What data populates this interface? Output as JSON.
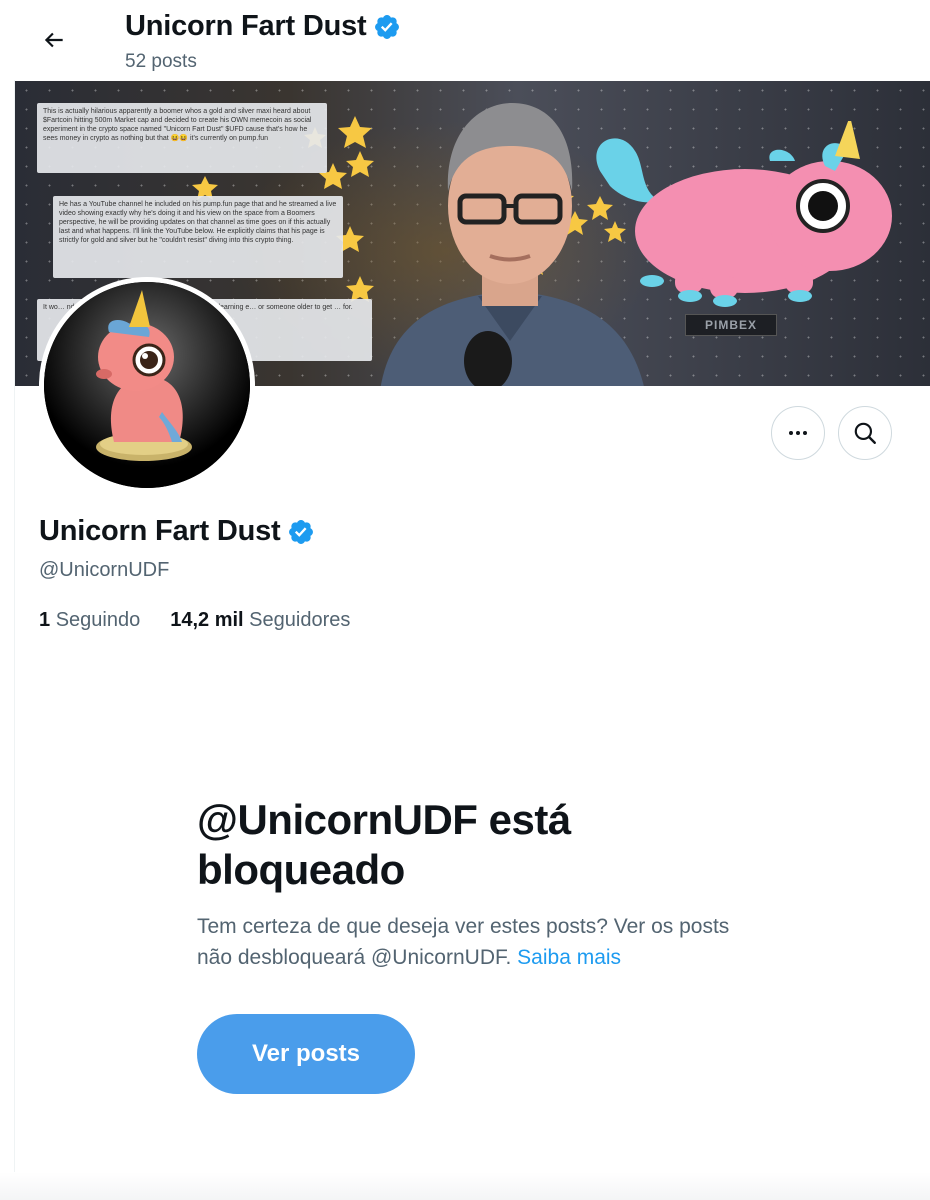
{
  "header": {
    "display_name": "Unicorn Fart Dust",
    "post_count": "52 posts"
  },
  "banner": {
    "caption_1": "This is actually hilarious apparently a boomer whos a gold and silver maxi heard about $Fartcoin hitting 500m Market cap and decided to create his OWN memecoin as social experiment in the crypto space named \"Unicorn Fart Dust\" $UFD cause that's how he sees money in crypto as nothing but that 😆😆 it's currently on pump.fun",
    "caption_2": "He has a YouTube channel he included on his pump.fun page that and he streamed a live video showing exactly why he's doing it and his view on the space from a Boomers perspective, he will be providing updates on that channel as time goes on if this actually last and what happens. I'll link the YouTube below. He explicitly claims that his page is strictly for gold and silver but he \"couldn't resist\" diving into this crypto thing.",
    "caption_3": "It wo… nd we completely shatter his pe… uld be a great learning e… or someone older to get … for.",
    "sign_text": "PIMBEX"
  },
  "profile": {
    "display_name": "Unicorn Fart Dust",
    "handle": "@UnicornUDF",
    "following_count": "1",
    "following_label": "Seguindo",
    "followers_count": "14,2 mil",
    "followers_label": "Seguidores"
  },
  "blocked": {
    "title": "@UnicornUDF está bloqueado",
    "description": "Tem certeza de que deseja ver estes posts? Ver os posts não desbloqueará @UnicornUDF.",
    "learn_more": "Saiba mais",
    "button_label": "Ver posts"
  },
  "icons": {
    "back": "arrow-left-icon",
    "verified": "verified-badge-icon",
    "more": "more-horizontal-icon",
    "search": "search-icon"
  },
  "colors": {
    "accent": "#1d9bf0",
    "button": "#4a9deb",
    "text_primary": "#0f1419",
    "text_secondary": "#536471",
    "verified": "#1d9bf0"
  }
}
